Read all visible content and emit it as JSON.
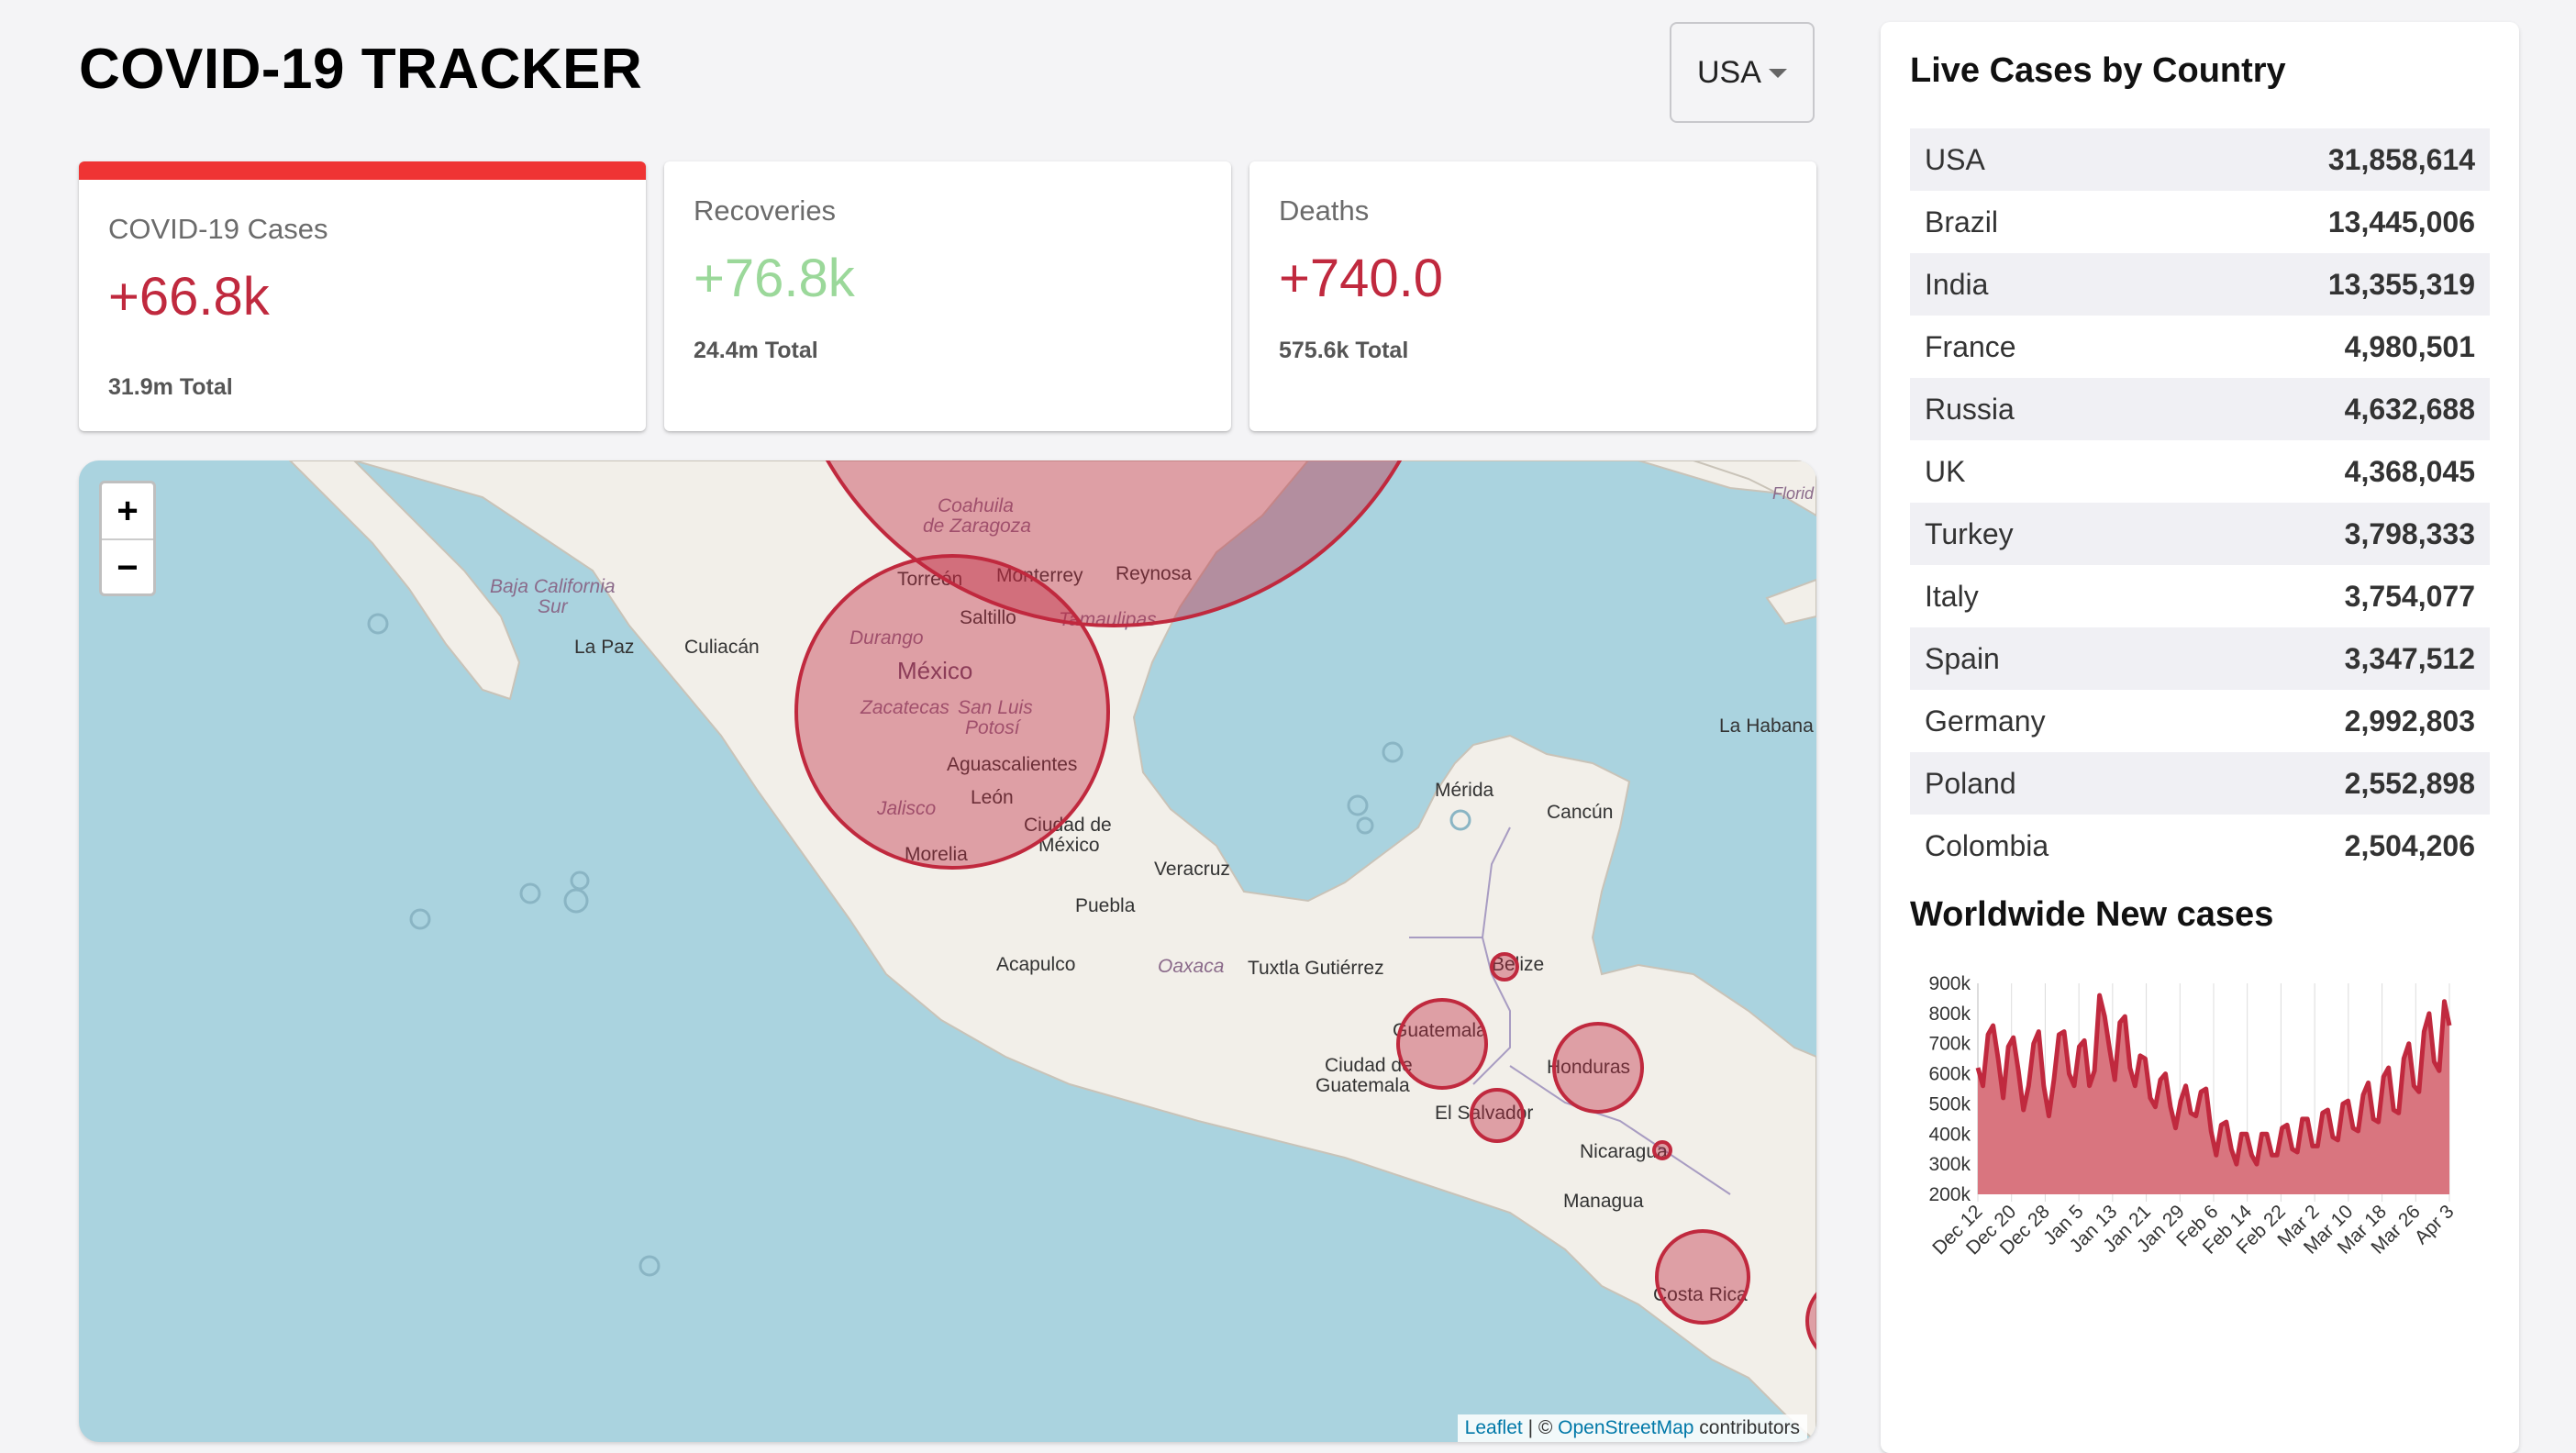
{
  "header": {
    "title": "COVID-19 TRACKER"
  },
  "country_select": {
    "value": "USA"
  },
  "cards": [
    {
      "title": "COVID-19 Cases",
      "value": "+66.8k",
      "total": "31.9m Total",
      "color": "#c0293e"
    },
    {
      "title": "Recoveries",
      "value": "+76.8k",
      "total": "24.4m Total",
      "color": "#9bd89a"
    },
    {
      "title": "Deaths",
      "value": "+740.0",
      "total": "575.6k Total",
      "color": "#c0293e"
    }
  ],
  "map": {
    "zoom_in": "+",
    "zoom_out": "−",
    "circle_color": "#c0293e",
    "attribution": {
      "leaflet": "Leaflet",
      "separator": " | © ",
      "osm": "OpenStreetMap",
      "contributors": " contributors"
    },
    "labels": {
      "coahuila": "Coahuila",
      "de_zaragoza": "de Zaragoza",
      "baja": "Baja California",
      "sur": "Sur",
      "la_paz": "La Paz",
      "culiacan": "Culiacán",
      "torreon": "Torreón",
      "monterrey": "Monterrey",
      "reynosa": "Reynosa",
      "saltillo": "Saltillo",
      "tamaulipas": "Tamaulipas",
      "durango": "Durango",
      "mexico": "México",
      "zacatecas": "Zacatecas",
      "san_luis": "San Luis",
      "potosi": "Potosí",
      "aguascalientes": "Aguascalientes",
      "leon": "León",
      "jalisco": "Jalisco",
      "morelia": "Morelia",
      "ciudad_de": "Ciudad de",
      "mexico_city": "México",
      "veracruz": "Veracruz",
      "puebla": "Puebla",
      "acapulco": "Acapulco",
      "oaxaca": "Oaxaca",
      "tuxtla": "Tuxtla Gutiérrez",
      "merida": "Mérida",
      "cancun": "Cancún",
      "la_habana": "La Habana",
      "florida": "Florid",
      "belize": "Belize",
      "guatemala": "Guatemala",
      "ciudad_de_guat": "Ciudad de",
      "guatemala_city": "Guatemala",
      "honduras": "Honduras",
      "el_salvador": "El Salvador",
      "nicaragua": "Nicaragua",
      "managua": "Managua",
      "costa_rica": "Costa Rica"
    }
  },
  "sidebar": {
    "table_title": "Live Cases by Country",
    "countries": [
      {
        "name": "USA",
        "cases": "31,858,614"
      },
      {
        "name": "Brazil",
        "cases": "13,445,006"
      },
      {
        "name": "India",
        "cases": "13,355,319"
      },
      {
        "name": "France",
        "cases": "4,980,501"
      },
      {
        "name": "Russia",
        "cases": "4,632,688"
      },
      {
        "name": "UK",
        "cases": "4,368,045"
      },
      {
        "name": "Turkey",
        "cases": "3,798,333"
      },
      {
        "name": "Italy",
        "cases": "3,754,077"
      },
      {
        "name": "Spain",
        "cases": "3,347,512"
      },
      {
        "name": "Germany",
        "cases": "2,992,803"
      },
      {
        "name": "Poland",
        "cases": "2,552,898"
      },
      {
        "name": "Colombia",
        "cases": "2,504,206"
      }
    ],
    "chart_title": "Worldwide New cases"
  },
  "chart_data": {
    "type": "area",
    "title": "Worldwide New cases",
    "xlabel": "",
    "ylabel": "",
    "x_ticks": [
      "Dec 12",
      "Dec 20",
      "Dec 28",
      "Jan 5",
      "Jan 13",
      "Jan 21",
      "Jan 29",
      "Feb 6",
      "Feb 14",
      "Feb 22",
      "Mar 2",
      "Mar 10",
      "Mar 18",
      "Mar 26",
      "Apr 3"
    ],
    "y_ticks": [
      "200k",
      "300k",
      "400k",
      "500k",
      "600k",
      "700k",
      "800k",
      "900k"
    ],
    "ylim": [
      200000,
      900000
    ],
    "fill_color": "#d9757f",
    "line_color": "#c0293e",
    "series": [
      {
        "values": [
          620000,
          560000,
          730000,
          760000,
          650000,
          520000,
          690000,
          720000,
          610000,
          480000,
          560000,
          700000,
          740000,
          560000,
          460000,
          580000,
          730000,
          740000,
          600000,
          560000,
          690000,
          710000,
          560000,
          610000,
          860000,
          790000,
          680000,
          580000,
          770000,
          790000,
          620000,
          560000,
          660000,
          650000,
          520000,
          490000,
          580000,
          600000,
          490000,
          420000,
          510000,
          560000,
          470000,
          460000,
          540000,
          550000,
          410000,
          330000,
          430000,
          440000,
          350000,
          300000,
          400000,
          400000,
          330000,
          300000,
          400000,
          400000,
          330000,
          330000,
          420000,
          430000,
          350000,
          340000,
          450000,
          450000,
          360000,
          360000,
          470000,
          480000,
          390000,
          380000,
          500000,
          510000,
          420000,
          410000,
          530000,
          570000,
          450000,
          440000,
          590000,
          620000,
          480000,
          470000,
          650000,
          700000,
          560000,
          540000,
          740000,
          800000,
          640000,
          610000,
          840000,
          760000
        ]
      }
    ]
  }
}
